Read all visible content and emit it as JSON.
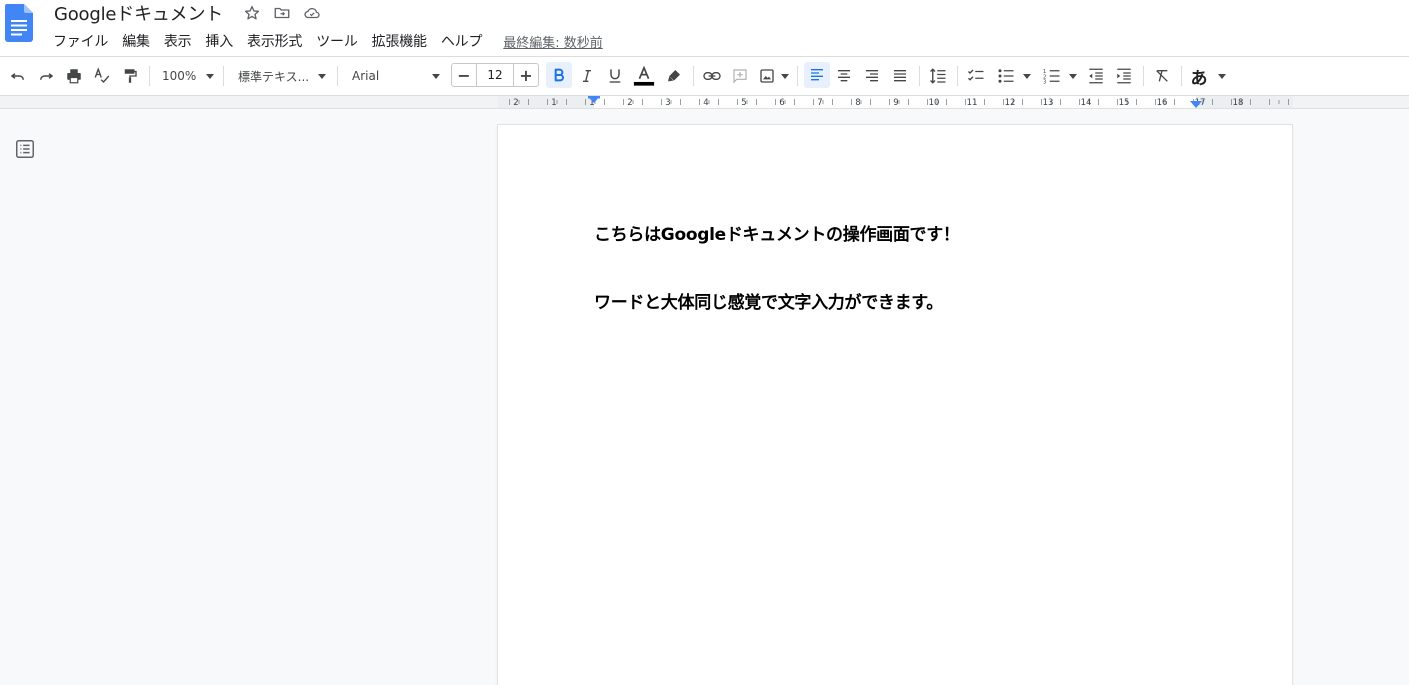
{
  "app": {
    "title": "Googleドキュメント",
    "accent_color": "#4285f4",
    "icons": [
      "docs-logo-icon",
      "star-icon",
      "move-to-folder-icon",
      "cloud-saved-icon"
    ]
  },
  "menu": {
    "items": [
      "ファイル",
      "編集",
      "表示",
      "挿入",
      "表示形式",
      "ツール",
      "拡張機能",
      "ヘルプ"
    ],
    "last_edit": "最終編集: 数秒前"
  },
  "toolbar": {
    "zoom": "100%",
    "style": "標準テキス...",
    "font": "Arial",
    "font_size": "12",
    "input_tool": "あ",
    "bold_active": true,
    "align_left_active": true,
    "text_color": "#000000",
    "icons": [
      "undo-icon",
      "redo-icon",
      "print-icon",
      "spellcheck-icon",
      "paint-format-icon",
      "bold-icon",
      "italic-icon",
      "underline-icon",
      "text-color-icon",
      "highlight-icon",
      "link-icon",
      "add-comment-icon",
      "image-icon",
      "align-left-icon",
      "align-center-icon",
      "align-right-icon",
      "justify-icon",
      "line-spacing-icon",
      "checklist-icon",
      "bulleted-list-icon",
      "numbered-list-icon",
      "decrease-indent-icon",
      "increase-indent-icon",
      "clear-formatting-icon"
    ]
  },
  "ruler": {
    "labels": [
      "2",
      "1",
      "1",
      "2",
      "3",
      "4",
      "5",
      "6",
      "7",
      "8",
      "9",
      "10",
      "11",
      "12",
      "13",
      "14",
      "15",
      "16",
      "17",
      "18"
    ]
  },
  "document": {
    "paragraphs": [
      "こちらはGoogleドキュメントの操作画面です！",
      "ワードと大体同じ感覚で文字入力ができます。"
    ]
  }
}
